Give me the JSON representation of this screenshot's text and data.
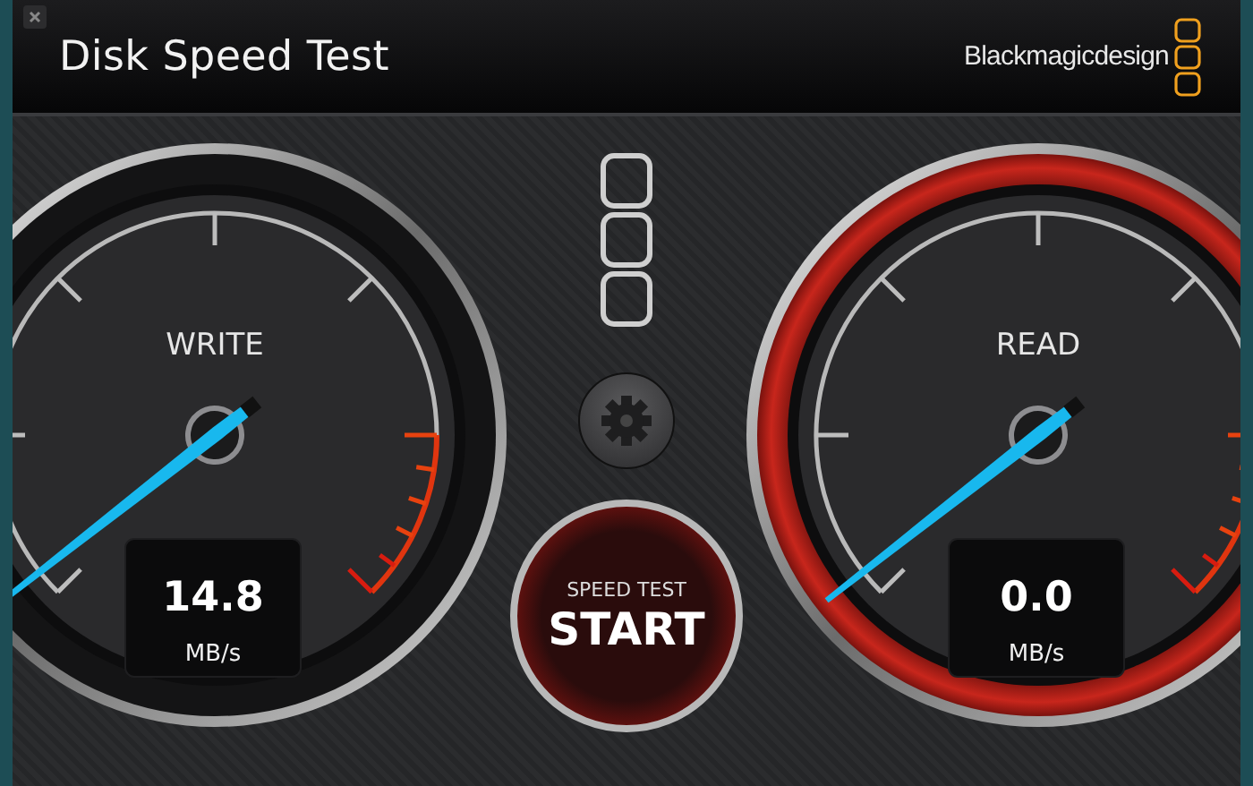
{
  "window": {
    "title": "Disk Speed Test",
    "brand": "Blackmagicdesign"
  },
  "gauges": [
    {
      "label": "WRITE",
      "value": "14.8",
      "unit": "MB/s",
      "active": false
    },
    {
      "label": "READ",
      "value": "0.0",
      "unit": "MB/s",
      "active": true
    }
  ],
  "start_button": {
    "caption": "SPEED TEST",
    "label": "START"
  }
}
